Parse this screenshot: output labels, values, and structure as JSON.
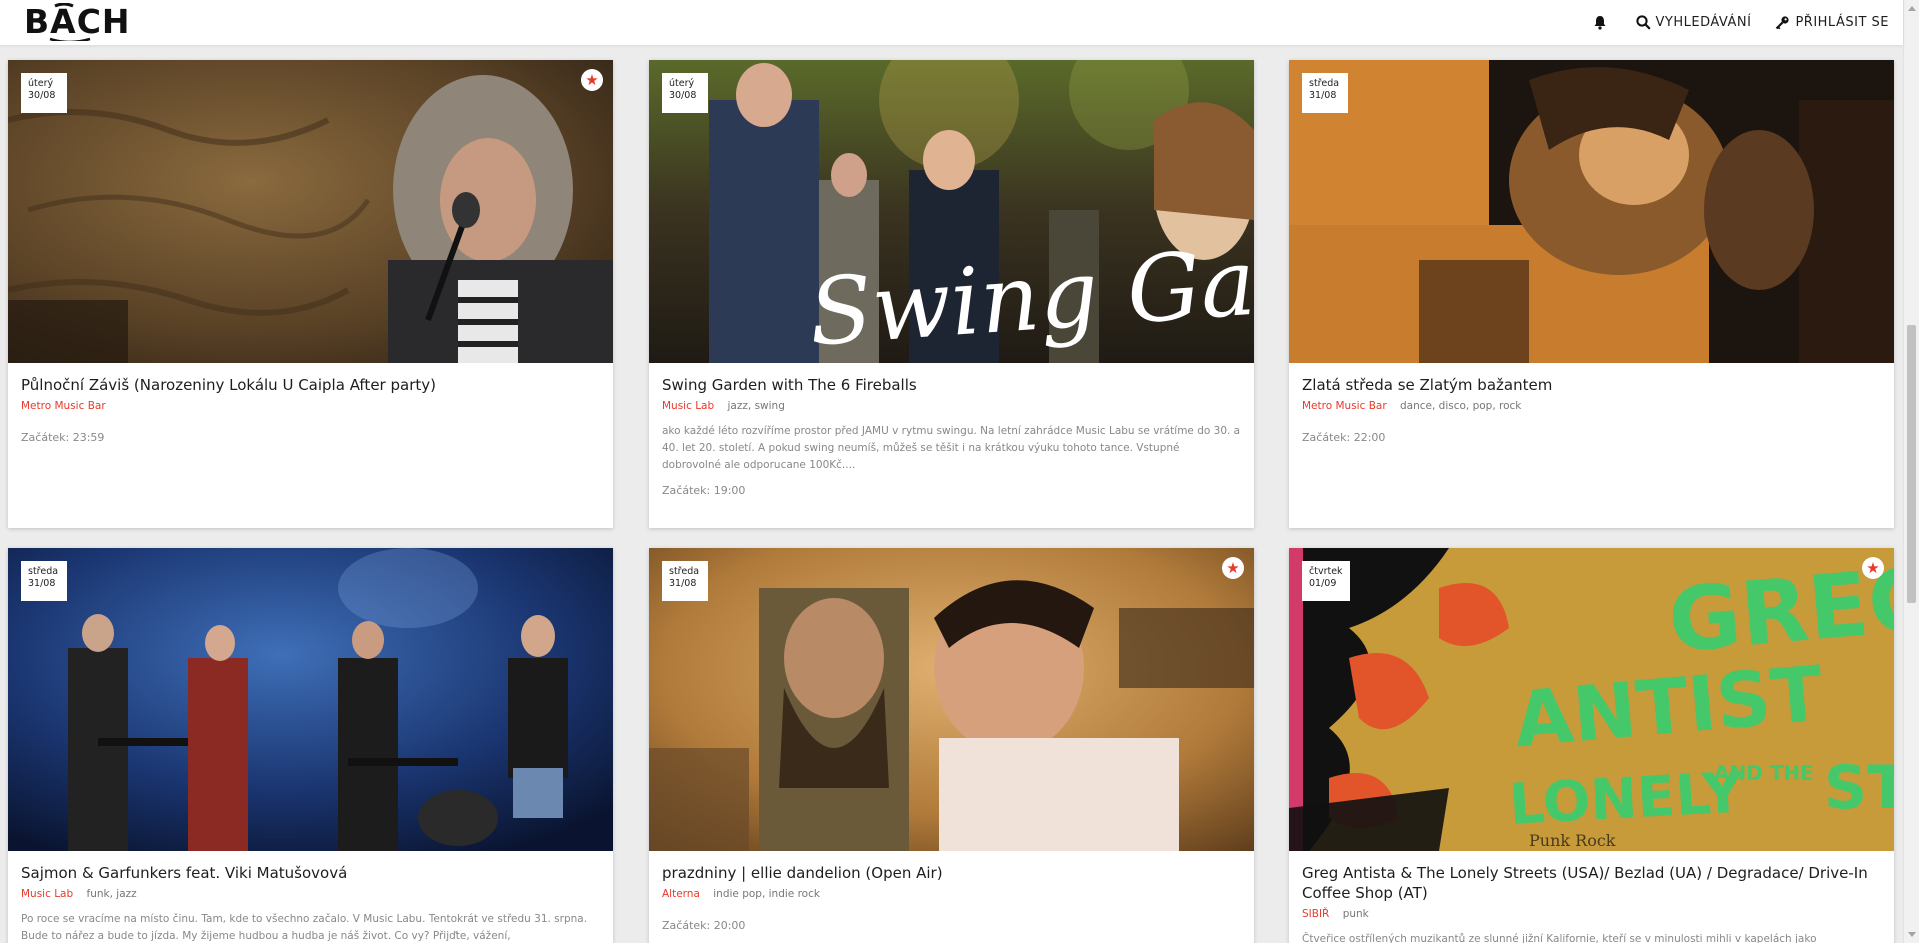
{
  "header": {
    "logo_text": "BACH",
    "search_label": "VYHLEDÁVÁNÍ",
    "login_label": "PŘIHLÁSIT SE"
  },
  "icons": {
    "bell": "bell-icon",
    "search": "search-icon",
    "key": "key-icon",
    "star": "star-icon"
  },
  "colors": {
    "accent": "#e8392b",
    "background": "#ececec",
    "card": "#ffffff"
  },
  "events": [
    {
      "day": "úterý",
      "date": "30/08",
      "featured": true,
      "title": "Půlnoční Záviš (Narozeniny Lokálu U Caipla After party)",
      "venue": "Metro Music Bar",
      "genres": "",
      "description": "",
      "start": "Začátek: 23:59"
    },
    {
      "day": "úterý",
      "date": "30/08",
      "featured": false,
      "image_text": "Swing Gar",
      "title": "Swing Garden with The 6 Fireballs",
      "venue": "Music Lab",
      "genres": "jazz, swing",
      "description": "ako každé léto rozvíříme prostor před JAMU v rytmu swingu. Na letní zahrádce Music Labu se vrátíme do 30. a 40. let 20. století. A pokud swing neumíš, můžeš se těšit i na krátkou výuku tohoto tance. Vstupné dobrovolné ale odporucane 100Kč....",
      "start": "Začátek: 19:00"
    },
    {
      "day": "středa",
      "date": "31/08",
      "featured": false,
      "title": "Zlatá středa se Zlatým bažantem",
      "venue": "Metro Music Bar",
      "genres": "dance, disco, pop, rock",
      "description": "",
      "start": "Začátek: 22:00"
    },
    {
      "day": "středa",
      "date": "31/08",
      "featured": false,
      "title": "Sajmon & Garfunkers feat. Viki Matušovová",
      "venue": "Music Lab",
      "genres": "funk, jazz",
      "description": "Po roce se vracíme na místo činu. Tam, kde to všechno začalo. V Music Labu. Tentokrát ve středu 31. srpna. Bude to nářez a bude to jízda. My žijeme hudbou a hudba je náš život. Co vy? Přijďte, vážení,",
      "start": ""
    },
    {
      "day": "středa",
      "date": "31/08",
      "featured": true,
      "title": "prazdniny | ellie dandelion (Open Air)",
      "venue": "Alterna",
      "genres": "indie pop, indie rock",
      "description": "",
      "start": "Začátek: 20:00"
    },
    {
      "day": "čtvrtek",
      "date": "01/09",
      "featured": true,
      "image_text_1": "GREG",
      "image_text_2": "ANTIST",
      "image_text_3": "LONELY",
      "image_text_4": "AND THE",
      "image_text_5": "STR",
      "image_text_6": "Punk Rock",
      "title": "Greg Antista & The Lonely Streets (USA)/ Bezlad (UA) / Degradace/ Drive-In Coffee Shop (AT)",
      "venue": "SIBIŘ",
      "genres": "punk",
      "description": "Čtveřice ostřílených muzikantů ze slunné jižní Kalifornie, kteří se v minulosti mihli v kapelách jako",
      "start": ""
    }
  ]
}
